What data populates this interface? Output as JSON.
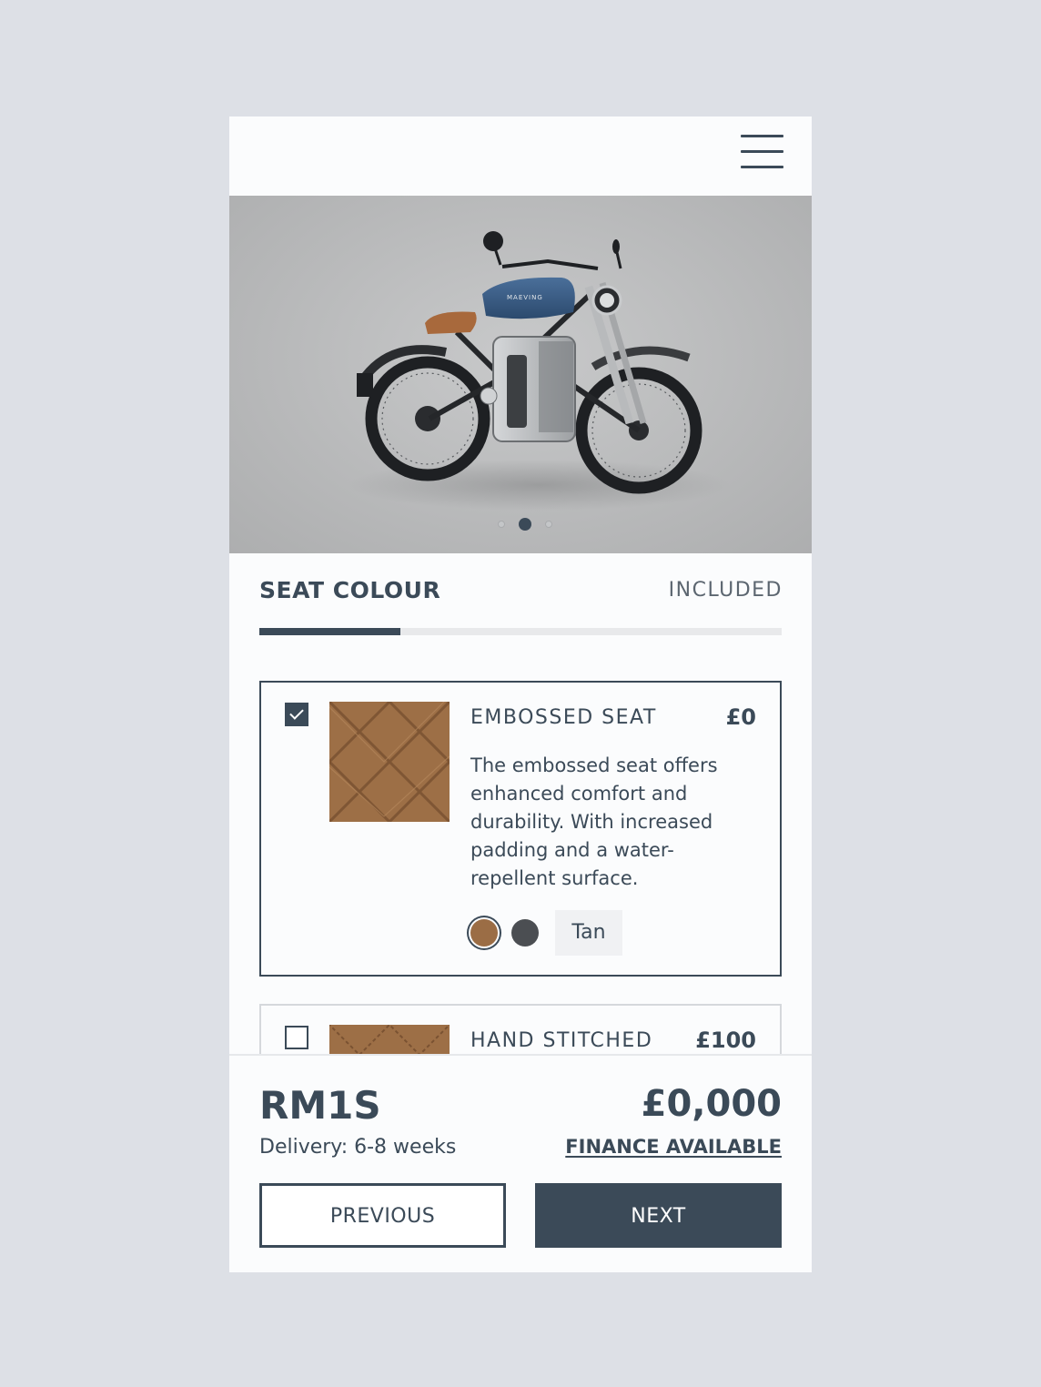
{
  "header": {
    "menu_icon": "hamburger-menu-icon"
  },
  "hero": {
    "image": "motorcycle-photo",
    "tank_brand": "MAEVING",
    "carousel": {
      "count": 3,
      "active_index": 1
    }
  },
  "section": {
    "title": "SEAT COLOUR",
    "status": "INCLUDED",
    "progress_fraction": 0.27
  },
  "options": [
    {
      "name": "EMBOSSED SEAT",
      "price": "£0",
      "selected": true,
      "description": "The embossed seat offers enhanced comfort and durability. With increased padding and a water-repellent surface.",
      "colours": [
        {
          "name": "Tan",
          "hex": "#9b6d45",
          "selected": true
        },
        {
          "name": "Black",
          "hex": "#4b4e52",
          "selected": false
        }
      ],
      "selected_colour_label": "Tan"
    },
    {
      "name": "HAND STITCHED",
      "price": "£100",
      "selected": false
    }
  ],
  "footer": {
    "model": "RM1S",
    "delivery": "Delivery: 6-8 weeks",
    "total": "£0,000",
    "finance_link": "FINANCE AVAILABLE",
    "previous_label": "PREVIOUS",
    "next_label": "NEXT"
  },
  "colors": {
    "primary": "#3b4a58",
    "page_bg": "#dde0e6",
    "card_bg": "#fbfcfd"
  }
}
